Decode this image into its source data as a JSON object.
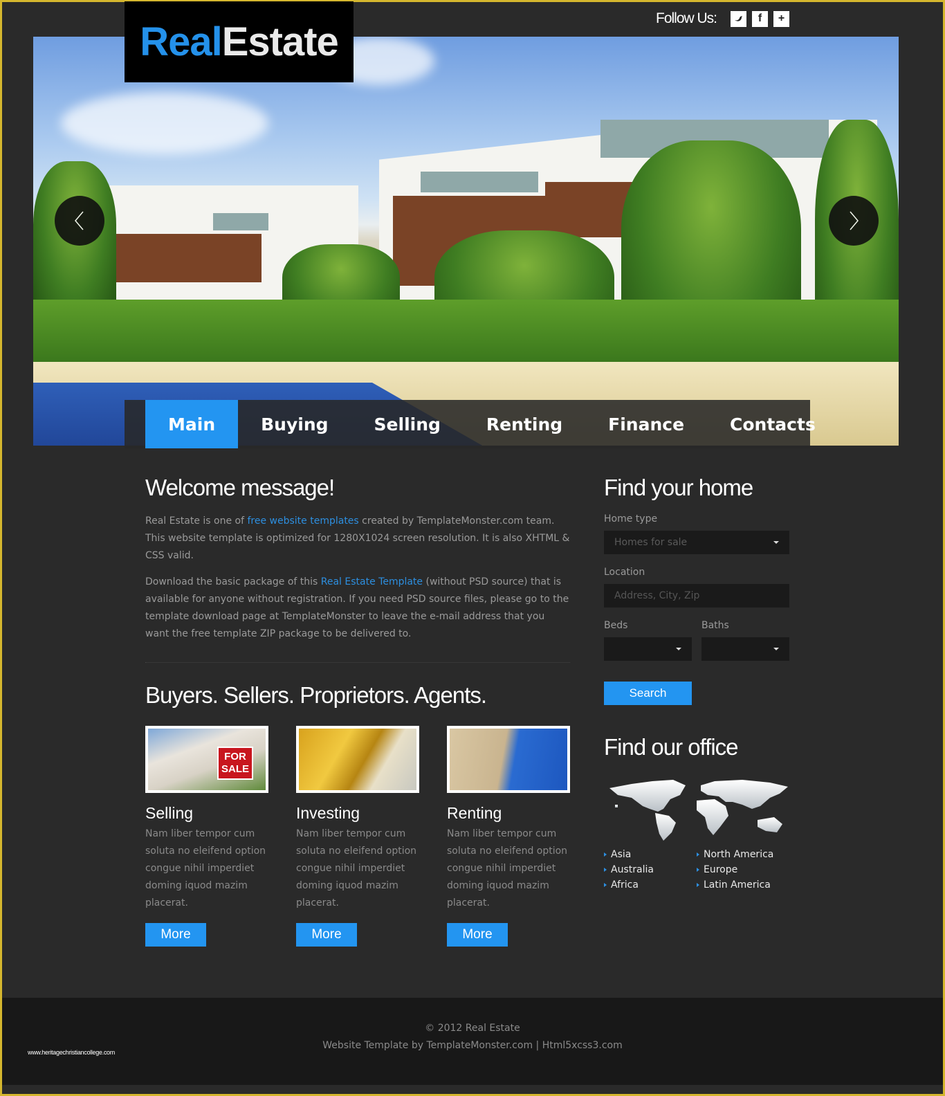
{
  "header": {
    "logo_part1": "Real",
    "logo_part2": "Estate",
    "follow_label": "Follow Us:",
    "social": [
      {
        "name": "twitter-icon",
        "glyph": "t"
      },
      {
        "name": "facebook-icon",
        "glyph": "f"
      },
      {
        "name": "plus-icon",
        "glyph": "+"
      }
    ]
  },
  "slider": {
    "prev_glyph": "‹",
    "next_glyph": "›"
  },
  "nav": {
    "items": [
      "Main",
      "Buying",
      "Selling",
      "Renting",
      "Finance",
      "Contacts"
    ],
    "active": "Main"
  },
  "welcome": {
    "title": "Welcome message!",
    "p1_before": "Real Estate is one of ",
    "p1_link": "free website templates",
    "p1_after": " created by TemplateMonster.com team. This website template is optimized for 1280X1024 screen resolution. It is also XHTML & CSS valid.",
    "p2_before": "Download the basic package of this ",
    "p2_link": "Real Estate Template",
    "p2_after": " (without PSD source) that is available for anyone without registration. If you need PSD source files, please go to the template download page at TemplateMonster to leave the e-mail address that you want the free template ZIP package to be delivered to."
  },
  "services": {
    "title": "Buyers. Sellers. Proprietors. Agents.",
    "cards": [
      {
        "title": "Selling",
        "text": "Nam liber tempor cum soluta no eleifend option congue nihil imperdiet doming iquod mazim placerat.",
        "button": "More",
        "sign": "FOR SALE"
      },
      {
        "title": "Investing",
        "text": "Nam liber tempor cum soluta no eleifend option congue nihil imperdiet doming iquod mazim placerat.",
        "button": "More"
      },
      {
        "title": "Renting",
        "text": "Nam liber tempor cum soluta no eleifend option congue nihil imperdiet doming iquod mazim placerat.",
        "button": "More"
      }
    ]
  },
  "search": {
    "title": "Find your home",
    "home_type_label": "Home type",
    "home_type_value": "Homes for sale",
    "location_label": "Location",
    "location_placeholder": "Address, City, Zip",
    "beds_label": "Beds",
    "baths_label": "Baths",
    "beds_value": "",
    "baths_value": "",
    "button": "Search"
  },
  "office": {
    "title": "Find our office",
    "regions": [
      "Asia",
      "North America",
      "Australia",
      "Europe",
      "Africa",
      "Latin America"
    ]
  },
  "footer": {
    "copyright": "© 2012 Real Estate",
    "credits": "Website Template by TemplateMonster.com | Html5xcss3.com",
    "watermark": "www.heritagechristiancollege.com"
  },
  "colors": {
    "accent": "#2395f1",
    "background": "#2a2a2a",
    "footer": "#181818",
    "border": "#d4b62e"
  }
}
